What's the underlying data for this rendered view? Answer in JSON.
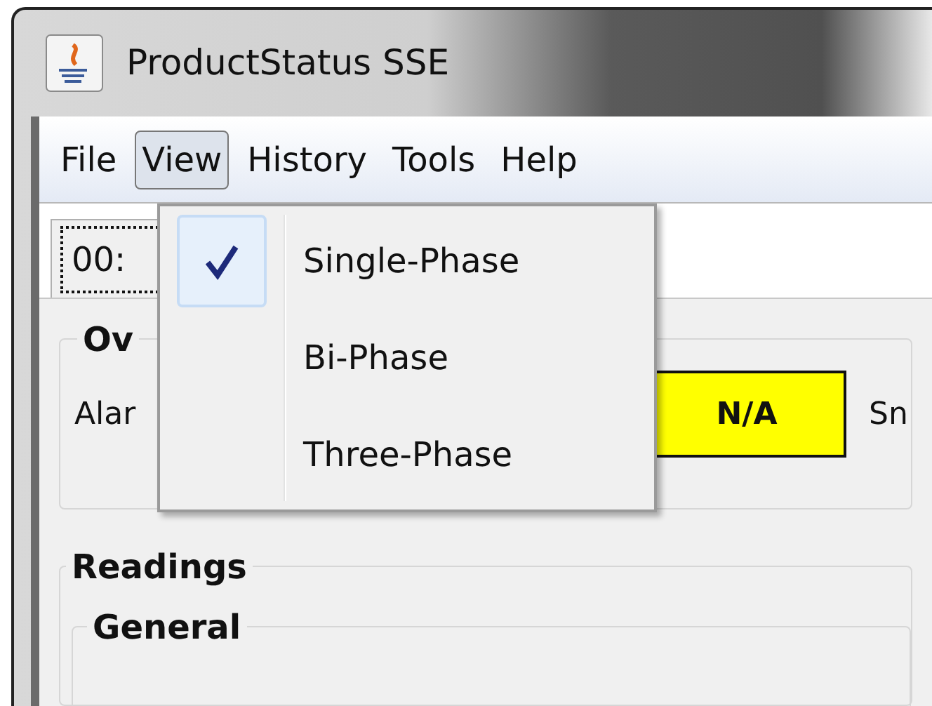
{
  "window": {
    "title": "ProductStatus SSE"
  },
  "menu_bar": [
    {
      "label": "File",
      "selected": false
    },
    {
      "label": "View",
      "selected": true
    },
    {
      "label": "History",
      "selected": false
    },
    {
      "label": "Tools",
      "selected": false
    },
    {
      "label": "Help",
      "selected": false
    }
  ],
  "view_menu": {
    "items": [
      {
        "label": "Single-Phase",
        "checked": true
      },
      {
        "label": "Bi-Phase",
        "checked": false
      },
      {
        "label": "Three-Phase",
        "checked": false
      }
    ]
  },
  "tab": {
    "label": "00:"
  },
  "overview": {
    "title": "Ov",
    "alarm_label": "Alar",
    "status": "N/A",
    "next_label": "Sn"
  },
  "readings": {
    "title": "Readings",
    "general": {
      "title": "General"
    }
  }
}
